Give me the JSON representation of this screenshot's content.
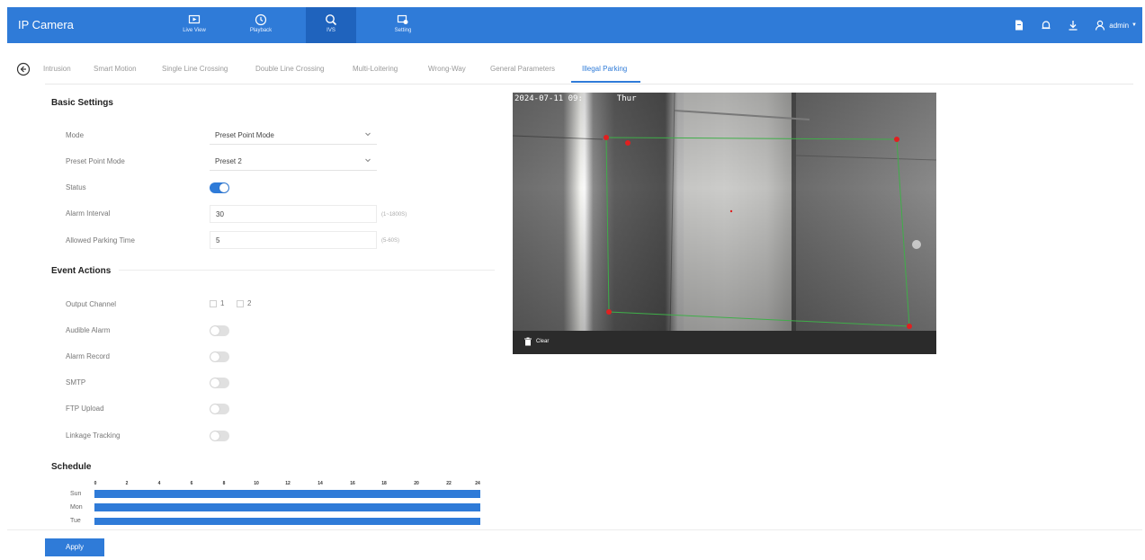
{
  "app": {
    "title": "IP Camera"
  },
  "nav": [
    {
      "label": "Live View",
      "icon": "live-view-icon"
    },
    {
      "label": "Playback",
      "icon": "playback-icon"
    },
    {
      "label": "IVS",
      "icon": "ivs-icon"
    },
    {
      "label": "Setting",
      "icon": "setting-icon"
    }
  ],
  "nav_active": "IVS",
  "user": {
    "name": "admin"
  },
  "tabs": [
    "Intrusion",
    "Smart Motion",
    "Single Line Crossing",
    "Double Line Crossing",
    "Multi-Loitering",
    "Wrong-Way",
    "General Parameters",
    "Illegal Parking"
  ],
  "active_tab": "Illegal Parking",
  "basic": {
    "title": "Basic Settings",
    "mode_label": "Mode",
    "mode_value": "Preset Point Mode",
    "preset_label": "Preset Point Mode",
    "preset_value": "Preset 2",
    "status_label": "Status",
    "status_on": true,
    "alarm_interval_label": "Alarm Interval",
    "alarm_interval_value": "30",
    "alarm_interval_hint": "(1~1800S)",
    "parking_time_label": "Allowed Parking Time",
    "parking_time_value": "5",
    "parking_time_hint": "(5-60S)"
  },
  "events": {
    "title": "Event Actions",
    "output_channel_label": "Output Channel",
    "output_channels": [
      "1",
      "2"
    ],
    "audible_alarm_label": "Audible Alarm",
    "alarm_record_label": "Alarm Record",
    "smtp_label": "SMTP",
    "ftp_label": "FTP Upload",
    "linkage_label": "Linkage Tracking"
  },
  "schedule": {
    "title": "Schedule",
    "hours": [
      "0",
      "2",
      "4",
      "6",
      "8",
      "10",
      "12",
      "14",
      "16",
      "18",
      "20",
      "22",
      "24"
    ],
    "days": [
      "Sun",
      "Mon",
      "Tue"
    ]
  },
  "video": {
    "osd_date": "2024-07-11",
    "osd_time": "09:",
    "osd_day": "Thur",
    "clear_label": "Clear"
  },
  "apply_label": "Apply",
  "colors": {
    "primary": "#2f7bd8",
    "region": "#3fae49",
    "point": "#e02020"
  }
}
